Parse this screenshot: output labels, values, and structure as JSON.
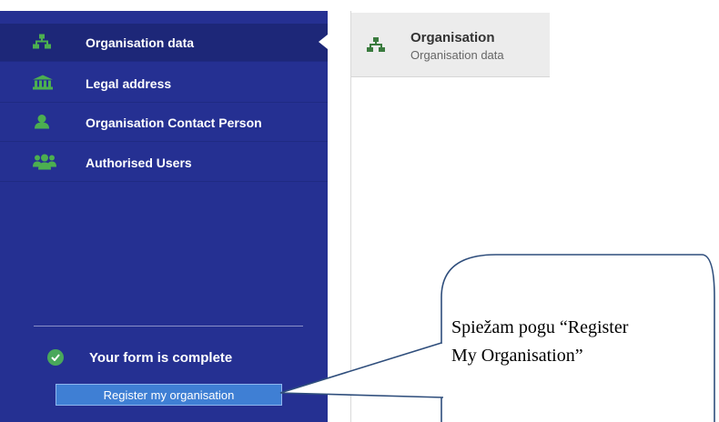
{
  "sidebar": {
    "items": [
      {
        "label": "Organisation data",
        "icon": "sitemap-icon"
      },
      {
        "label": "Legal address",
        "icon": "bank-icon"
      },
      {
        "label": "Organisation Contact Person",
        "icon": "user-icon"
      },
      {
        "label": "Authorised Users",
        "icon": "users-icon"
      }
    ],
    "status_text": "Your form is complete",
    "register_button": "Register my organisation"
  },
  "header": {
    "title": "Organisation",
    "subtitle": "Organisation data"
  },
  "callout": {
    "line1": "Spiežam pogu “Register",
    "line2": "My Organisation”"
  },
  "colors": {
    "sidebar": "#253092",
    "icon_green": "#4caf50",
    "button": "#3f7fd4"
  }
}
